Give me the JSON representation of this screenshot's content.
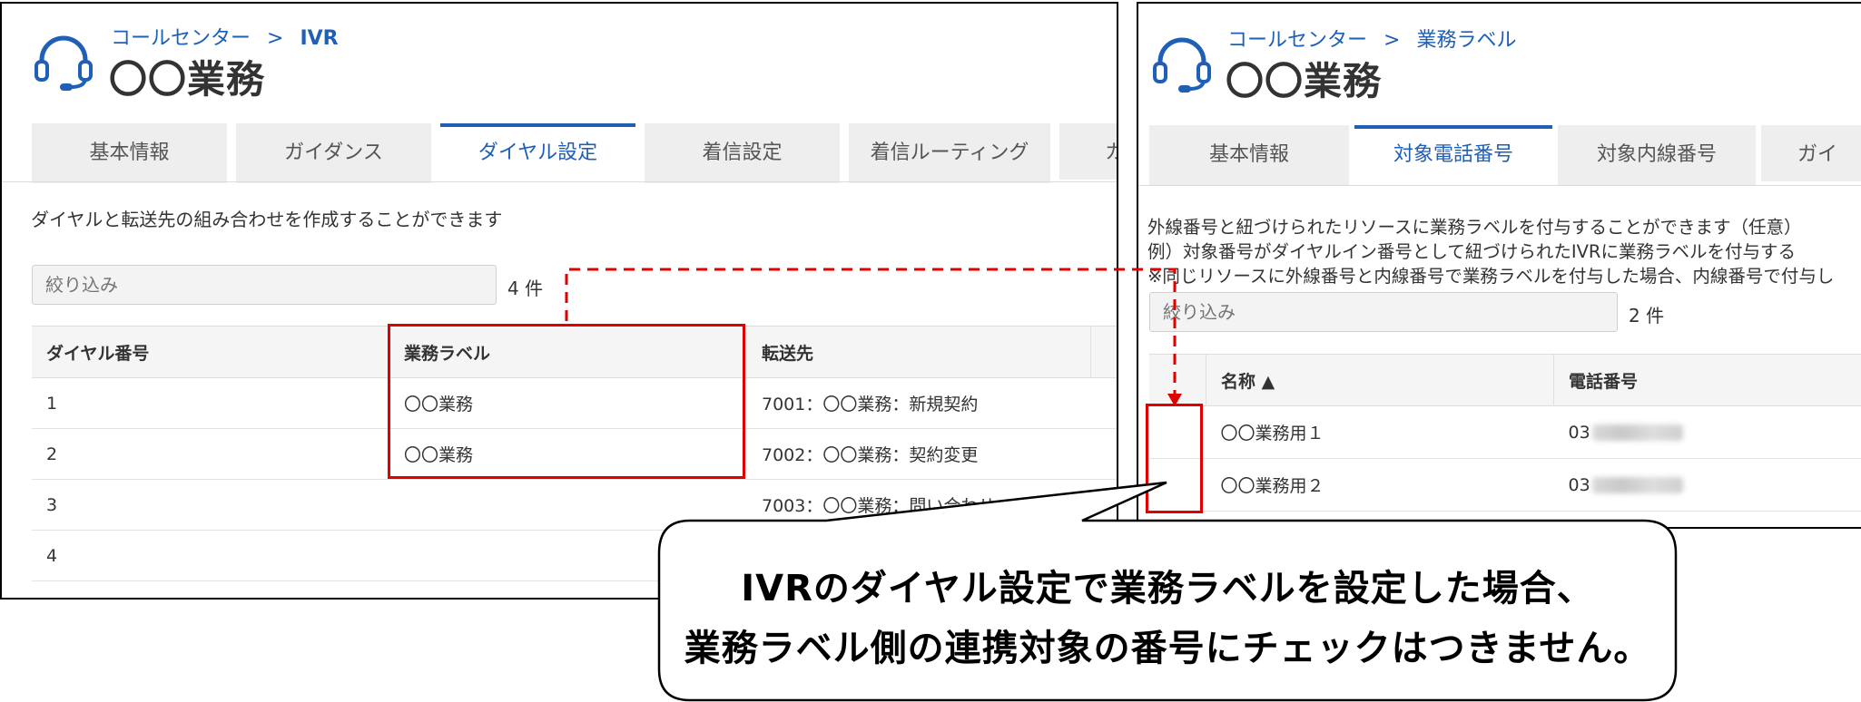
{
  "left": {
    "breadcrumb": {
      "root": "コールセンター",
      "sep": ">",
      "current": "IVR"
    },
    "title": "〇〇業務",
    "tabs": [
      "基本情報",
      "ガイダンス",
      "ダイヤル設定",
      "着信設定",
      "着信ルーティング",
      "カ"
    ],
    "active_tab": "ダイヤル設定",
    "description": "ダイヤルと転送先の組み合わせを作成することができます",
    "filter_placeholder": "絞り込み",
    "count": "4 件",
    "columns": [
      "ダイヤル番号",
      "業務ラベル",
      "転送先"
    ],
    "rows": [
      {
        "dial": "1",
        "label": "〇〇業務",
        "dest": "7001：〇〇業務：新規契約"
      },
      {
        "dial": "2",
        "label": "〇〇業務",
        "dest": "7002：〇〇業務：契約変更"
      },
      {
        "dial": "3",
        "label": "",
        "dest": "7003：〇〇業務：問い合わせ"
      },
      {
        "dial": "4",
        "label": "",
        "dest": ""
      }
    ]
  },
  "right": {
    "breadcrumb": {
      "root": "コールセンター",
      "sep": ">",
      "current": "業務ラベル"
    },
    "title": "〇〇業務",
    "tabs": [
      "基本情報",
      "対象電話番号",
      "対象内線番号",
      "ガイ"
    ],
    "active_tab": "対象電話番号",
    "description_lines": [
      "外線番号と紐づけられたリソースに業務ラベルを付与することができます（任意）",
      "例）対象番号がダイヤルイン番号として紐づけられたIVRに業務ラベルを付与する",
      "※同じリソースに外線番号と内線番号で業務ラベルを付与した場合、内線番号で付与し"
    ],
    "filter_placeholder": "絞り込み",
    "count": "2 件",
    "columns": [
      "名称 ▲",
      "電話番号"
    ],
    "rows": [
      {
        "name": "〇〇業務用１",
        "phone": "03"
      },
      {
        "name": "〇〇業務用２",
        "phone": "03"
      }
    ]
  },
  "callout": {
    "line1": "IVRのダイヤル設定で業務ラベルを設定した場合、",
    "line2": "業務ラベル側の連携対象の番号にチェックはつきません。"
  },
  "colors": {
    "accent": "#1f5fb5",
    "highlight": "#e00000",
    "tab_bg": "#eeeeee"
  },
  "icons": {
    "header": "headset-icon"
  }
}
